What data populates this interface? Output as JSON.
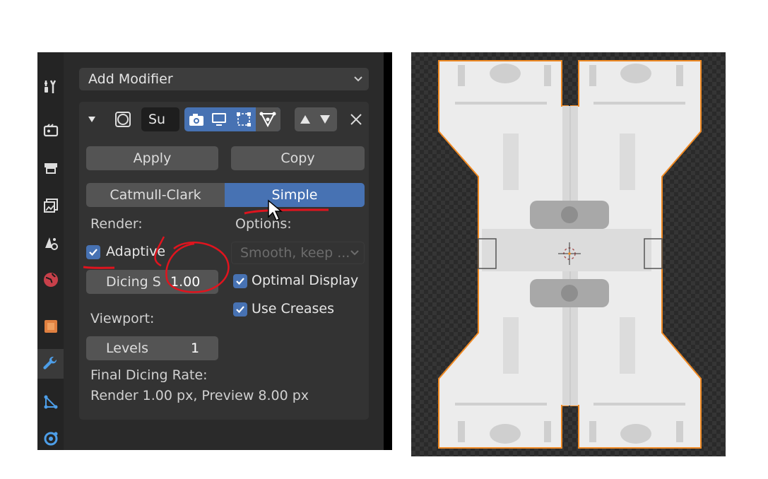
{
  "panel": {
    "add_modifier": "Add Modifier",
    "modifier_name": "Su",
    "apply": "Apply",
    "copy": "Copy",
    "mode_catmull": "Catmull-Clark",
    "mode_simple": "Simple",
    "render_label": "Render:",
    "options_label": "Options:",
    "adaptive_label": "Adaptive",
    "smooth_select": "Smooth, keep ...",
    "dicing_label": "Dicing S",
    "dicing_value": "1.00",
    "optimal_display": "Optimal Display",
    "use_creases": "Use Creases",
    "viewport_label": "Viewport:",
    "levels_label": "Levels",
    "levels_value": "1",
    "final_dicing_label": "Final Dicing Rate:",
    "final_dicing_value": "Render 1.00 px, Preview 8.00 px"
  },
  "colors": {
    "accent_blue": "#4772b3",
    "annotation_red": "#e0141e",
    "selection_orange": "#f08a24"
  },
  "icons": [
    "tool-icon",
    "render-icon",
    "output-icon",
    "view-layer-icon",
    "scene-icon",
    "world-icon",
    "object-icon",
    "modifier-wrench-icon",
    "particles-icon",
    "physics-icon"
  ]
}
